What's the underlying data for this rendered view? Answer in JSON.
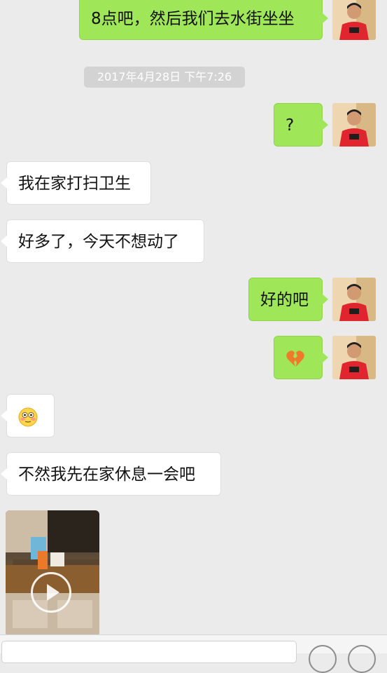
{
  "timestamp": "2017年4月28日 下午7:26",
  "messages": [
    {
      "side": "right",
      "text": "8点吧，然后我们去水街坐坐"
    },
    {
      "side": "right",
      "text": "?"
    },
    {
      "side": "left",
      "text": "我在家打扫卫生"
    },
    {
      "side": "left",
      "text": "好多了，今天不想动了"
    },
    {
      "side": "right",
      "text": "好的吧"
    },
    {
      "side": "right",
      "emoji": "broken-heart-emoji"
    },
    {
      "side": "left",
      "emoji": "flushed-face-emoji"
    },
    {
      "side": "left",
      "text": "不然我先在家休息一会吧"
    },
    {
      "side": "left",
      "media": "video-thumbnail"
    }
  ],
  "colors": {
    "background": "#ebebeb",
    "sent_bubble": "#9fe658",
    "received_bubble": "#ffffff",
    "timestamp_bg": "#d3d3d3"
  }
}
